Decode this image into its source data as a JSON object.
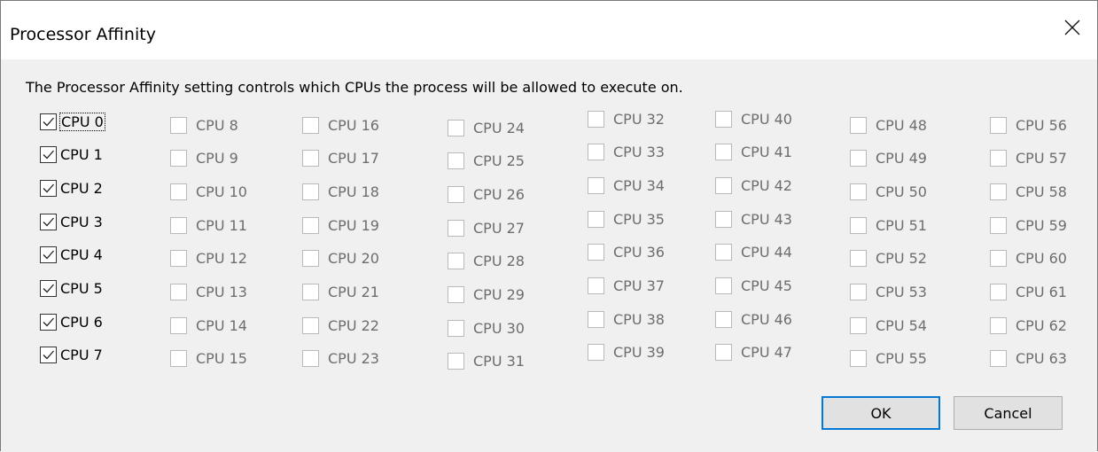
{
  "window": {
    "title": "Processor Affinity",
    "close_glyph": "close-icon"
  },
  "description": "The Processor Affinity setting controls which CPUs the process will be allowed to execute on.",
  "cpus": [
    {
      "label": "CPU 0",
      "checked": true,
      "enabled": true
    },
    {
      "label": "CPU 1",
      "checked": true,
      "enabled": true
    },
    {
      "label": "CPU 2",
      "checked": true,
      "enabled": true
    },
    {
      "label": "CPU 3",
      "checked": true,
      "enabled": true
    },
    {
      "label": "CPU 4",
      "checked": true,
      "enabled": true
    },
    {
      "label": "CPU 5",
      "checked": true,
      "enabled": true
    },
    {
      "label": "CPU 6",
      "checked": true,
      "enabled": true
    },
    {
      "label": "CPU 7",
      "checked": true,
      "enabled": true
    },
    {
      "label": "CPU 8",
      "checked": false,
      "enabled": false
    },
    {
      "label": "CPU 9",
      "checked": false,
      "enabled": false
    },
    {
      "label": "CPU 10",
      "checked": false,
      "enabled": false
    },
    {
      "label": "CPU 11",
      "checked": false,
      "enabled": false
    },
    {
      "label": "CPU 12",
      "checked": false,
      "enabled": false
    },
    {
      "label": "CPU 13",
      "checked": false,
      "enabled": false
    },
    {
      "label": "CPU 14",
      "checked": false,
      "enabled": false
    },
    {
      "label": "CPU 15",
      "checked": false,
      "enabled": false
    },
    {
      "label": "CPU 16",
      "checked": false,
      "enabled": false
    },
    {
      "label": "CPU 17",
      "checked": false,
      "enabled": false
    },
    {
      "label": "CPU 18",
      "checked": false,
      "enabled": false
    },
    {
      "label": "CPU 19",
      "checked": false,
      "enabled": false
    },
    {
      "label": "CPU 20",
      "checked": false,
      "enabled": false
    },
    {
      "label": "CPU 21",
      "checked": false,
      "enabled": false
    },
    {
      "label": "CPU 22",
      "checked": false,
      "enabled": false
    },
    {
      "label": "CPU 23",
      "checked": false,
      "enabled": false
    },
    {
      "label": "CPU 24",
      "checked": false,
      "enabled": false
    },
    {
      "label": "CPU 25",
      "checked": false,
      "enabled": false
    },
    {
      "label": "CPU 26",
      "checked": false,
      "enabled": false
    },
    {
      "label": "CPU 27",
      "checked": false,
      "enabled": false
    },
    {
      "label": "CPU 28",
      "checked": false,
      "enabled": false
    },
    {
      "label": "CPU 29",
      "checked": false,
      "enabled": false
    },
    {
      "label": "CPU 30",
      "checked": false,
      "enabled": false
    },
    {
      "label": "CPU 31",
      "checked": false,
      "enabled": false
    },
    {
      "label": "CPU 32",
      "checked": false,
      "enabled": false
    },
    {
      "label": "CPU 33",
      "checked": false,
      "enabled": false
    },
    {
      "label": "CPU 34",
      "checked": false,
      "enabled": false
    },
    {
      "label": "CPU 35",
      "checked": false,
      "enabled": false
    },
    {
      "label": "CPU 36",
      "checked": false,
      "enabled": false
    },
    {
      "label": "CPU 37",
      "checked": false,
      "enabled": false
    },
    {
      "label": "CPU 38",
      "checked": false,
      "enabled": false
    },
    {
      "label": "CPU 39",
      "checked": false,
      "enabled": false
    },
    {
      "label": "CPU 40",
      "checked": false,
      "enabled": false
    },
    {
      "label": "CPU 41",
      "checked": false,
      "enabled": false
    },
    {
      "label": "CPU 42",
      "checked": false,
      "enabled": false
    },
    {
      "label": "CPU 43",
      "checked": false,
      "enabled": false
    },
    {
      "label": "CPU 44",
      "checked": false,
      "enabled": false
    },
    {
      "label": "CPU 45",
      "checked": false,
      "enabled": false
    },
    {
      "label": "CPU 46",
      "checked": false,
      "enabled": false
    },
    {
      "label": "CPU 47",
      "checked": false,
      "enabled": false
    },
    {
      "label": "CPU 48",
      "checked": false,
      "enabled": false
    },
    {
      "label": "CPU 49",
      "checked": false,
      "enabled": false
    },
    {
      "label": "CPU 50",
      "checked": false,
      "enabled": false
    },
    {
      "label": "CPU 51",
      "checked": false,
      "enabled": false
    },
    {
      "label": "CPU 52",
      "checked": false,
      "enabled": false
    },
    {
      "label": "CPU 53",
      "checked": false,
      "enabled": false
    },
    {
      "label": "CPU 54",
      "checked": false,
      "enabled": false
    },
    {
      "label": "CPU 55",
      "checked": false,
      "enabled": false
    },
    {
      "label": "CPU 56",
      "checked": false,
      "enabled": false
    },
    {
      "label": "CPU 57",
      "checked": false,
      "enabled": false
    },
    {
      "label": "CPU 58",
      "checked": false,
      "enabled": false
    },
    {
      "label": "CPU 59",
      "checked": false,
      "enabled": false
    },
    {
      "label": "CPU 60",
      "checked": false,
      "enabled": false
    },
    {
      "label": "CPU 61",
      "checked": false,
      "enabled": false
    },
    {
      "label": "CPU 62",
      "checked": false,
      "enabled": false
    },
    {
      "label": "CPU 63",
      "checked": false,
      "enabled": false
    }
  ],
  "focused_cpu": "CPU 0",
  "buttons": {
    "ok": "OK",
    "cancel": "Cancel"
  },
  "colors": {
    "default_button_border": "#0078d7",
    "disabled_text": "#6d6d6d"
  }
}
